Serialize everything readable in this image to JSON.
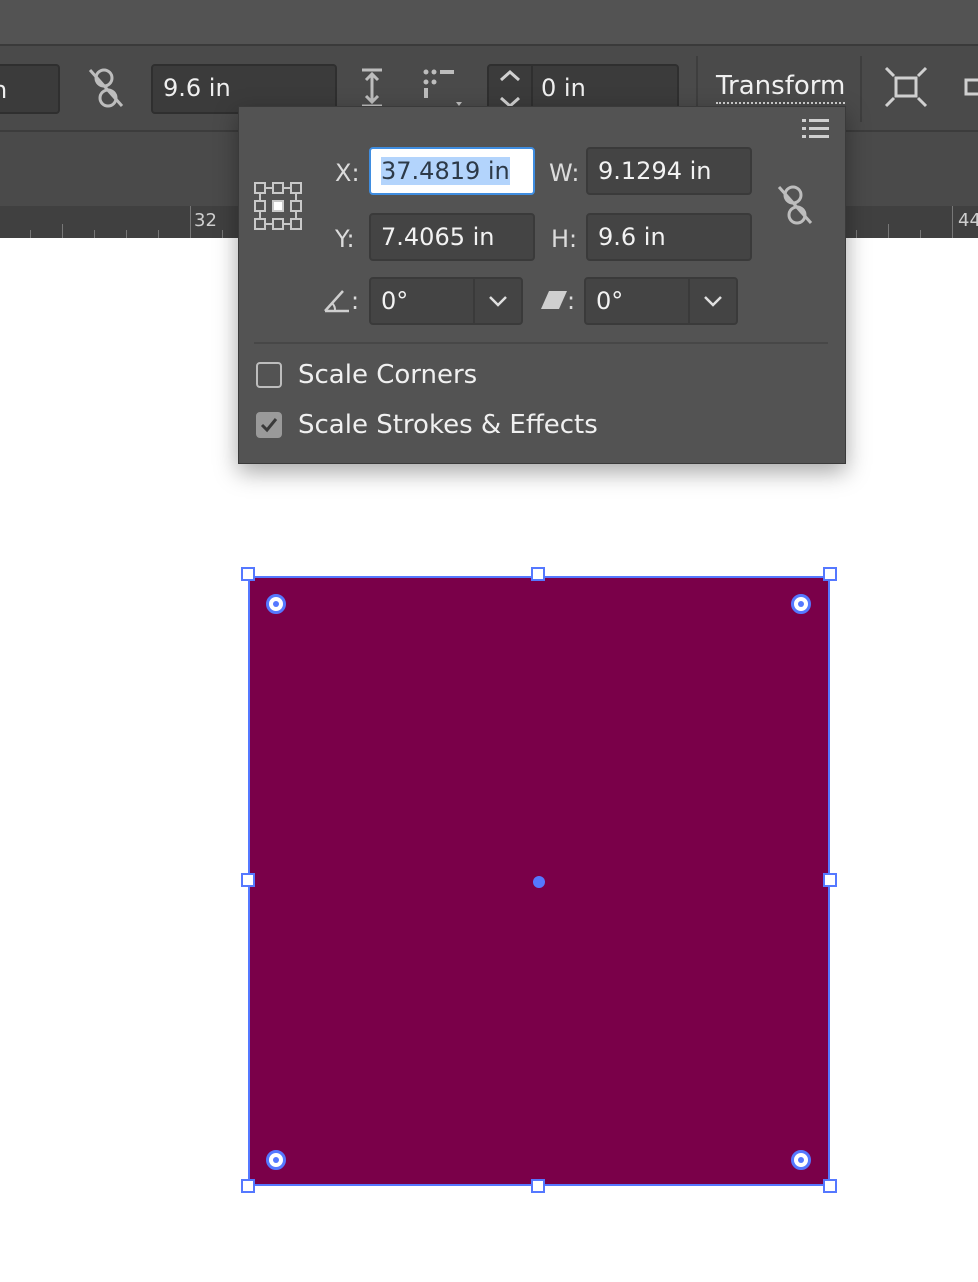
{
  "control_bar": {
    "height_value": "9.6 in",
    "offset_value": "0 in",
    "transform_label": "Transform"
  },
  "ruler": {
    "labels": [
      "32",
      "44"
    ]
  },
  "transform_popover": {
    "x_label": "X:",
    "x_value": "37.4819 in",
    "y_label": "Y:",
    "y_value": "7.4065 in",
    "w_label": "W:",
    "w_value": "9.1294 in",
    "h_label": "H:",
    "h_value": "9.6 in",
    "rotate_value": "0°",
    "shear_value": "0°",
    "colon": ":",
    "scale_corners_label": "Scale Corners",
    "scale_corners_checked": false,
    "scale_strokes_label": "Scale Strokes & Effects",
    "scale_strokes_checked": true
  },
  "colors": {
    "shape_fill": "#7a0049",
    "selection": "#5578ff",
    "accent_field": "#3f8de0"
  }
}
